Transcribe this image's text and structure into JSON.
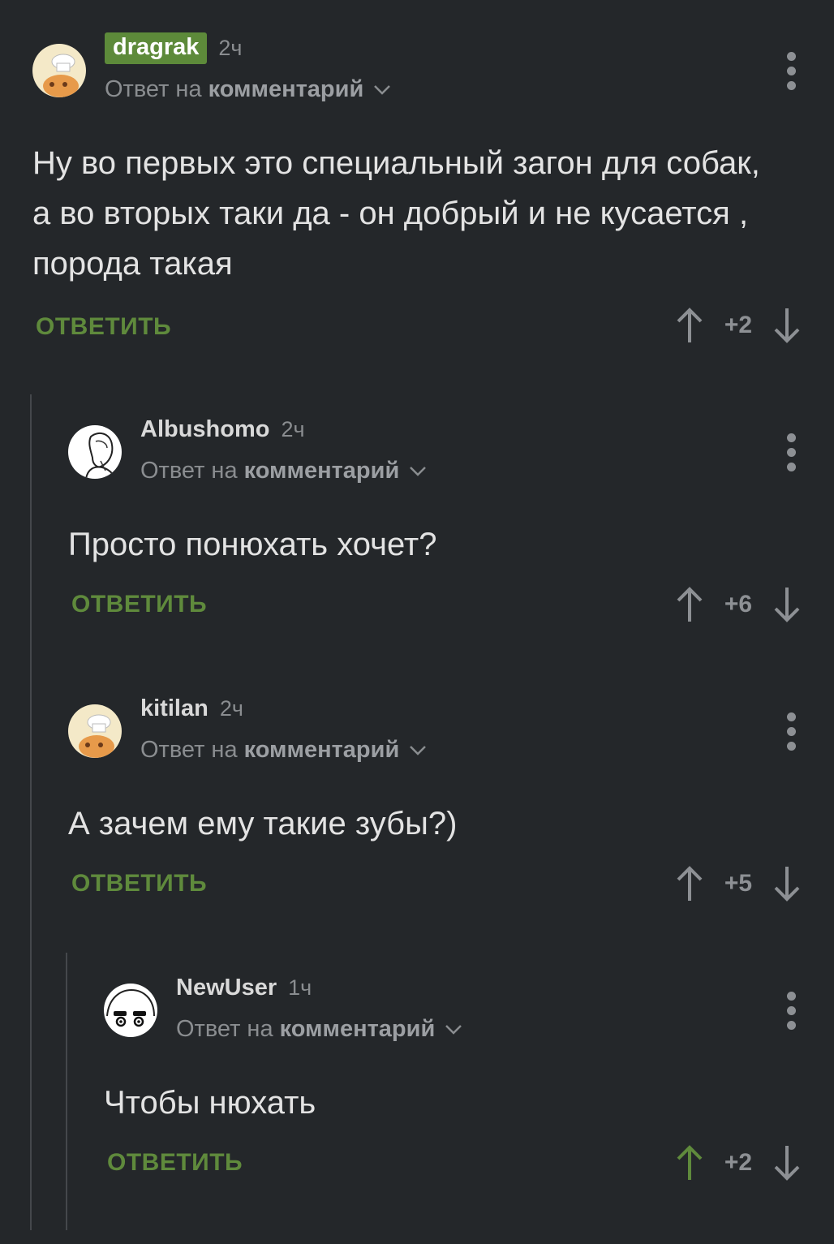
{
  "comments": [
    {
      "username": "dragrak",
      "time": "2ч",
      "reply_prefix": "Ответ на",
      "reply_target": "комментарий",
      "text": "Ну во первых это специальный загон для собак, а во вторых таки да  - он добрый и не кусается , порода такая",
      "reply_label": "ОТВЕТИТЬ",
      "score": "+2"
    },
    {
      "username": "Albushomo",
      "time": "2ч",
      "reply_prefix": "Ответ на",
      "reply_target": "комментарий",
      "text": "Просто понюхать хочет?",
      "reply_label": "ОТВЕТИТЬ",
      "score": "+6"
    },
    {
      "username": "kitilan",
      "time": "2ч",
      "reply_prefix": "Ответ на",
      "reply_target": "комментарий",
      "text": "А зачем ему такие зубы?)",
      "reply_label": "ОТВЕТИТЬ",
      "score": "+5"
    },
    {
      "username": "NewUser",
      "time": "1ч",
      "reply_prefix": "Ответ на",
      "reply_target": "комментарий",
      "text": "Чтобы нюхать",
      "reply_label": "ОТВЕТИТЬ",
      "score": "+2",
      "upvoted": true
    }
  ],
  "colors": {
    "background": "#24272a",
    "accent_green": "#5f8a3c",
    "badge_green": "#5d8a3a",
    "muted": "#8d9094"
  },
  "icons": [
    "avatar-chef-icon",
    "avatar-sketch-icon",
    "avatar-face-icon",
    "more-dots-icon",
    "chevron-down-icon",
    "upvote-arrow-icon",
    "downvote-arrow-icon"
  ]
}
